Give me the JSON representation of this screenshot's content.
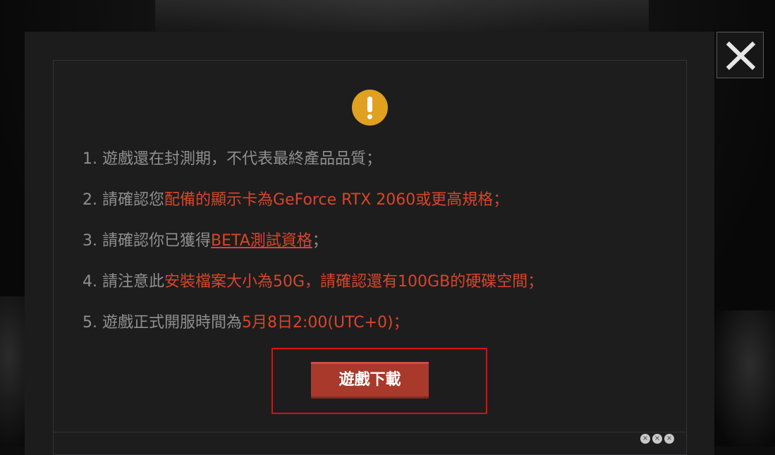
{
  "dialog": {
    "close_label": "×",
    "notices": [
      {
        "num": "1.",
        "plain": "遊戲還在封測期，不代表最終產品品質；"
      },
      {
        "num": "2.",
        "plain": "請確認您",
        "highlight": "配備的顯示卡為GeForce RTX 2060或更高規格；"
      },
      {
        "num": "3.",
        "plain": "請確認你已獲得",
        "link": "BETA測試資格",
        "tail": "；"
      },
      {
        "num": "4.",
        "plain": "請注意此",
        "highlight": "安裝檔案大小為50G，請確認還有100GB的硬碟空間；"
      },
      {
        "num": "5.",
        "plain": "遊戲正式開服時間為",
        "highlight": "5月8日2:00(UTC+0)；"
      }
    ],
    "download_label": "遊戲下載",
    "ad_controls": [
      "×",
      "×",
      "×"
    ]
  },
  "colors": {
    "accent_red": "#d9452a",
    "button_red": "#a8392b",
    "warning_yellow": "#e0a020",
    "focus_outline": "#e00d0d"
  },
  "icons": {
    "close": "close-icon",
    "warning": "warning-icon"
  }
}
